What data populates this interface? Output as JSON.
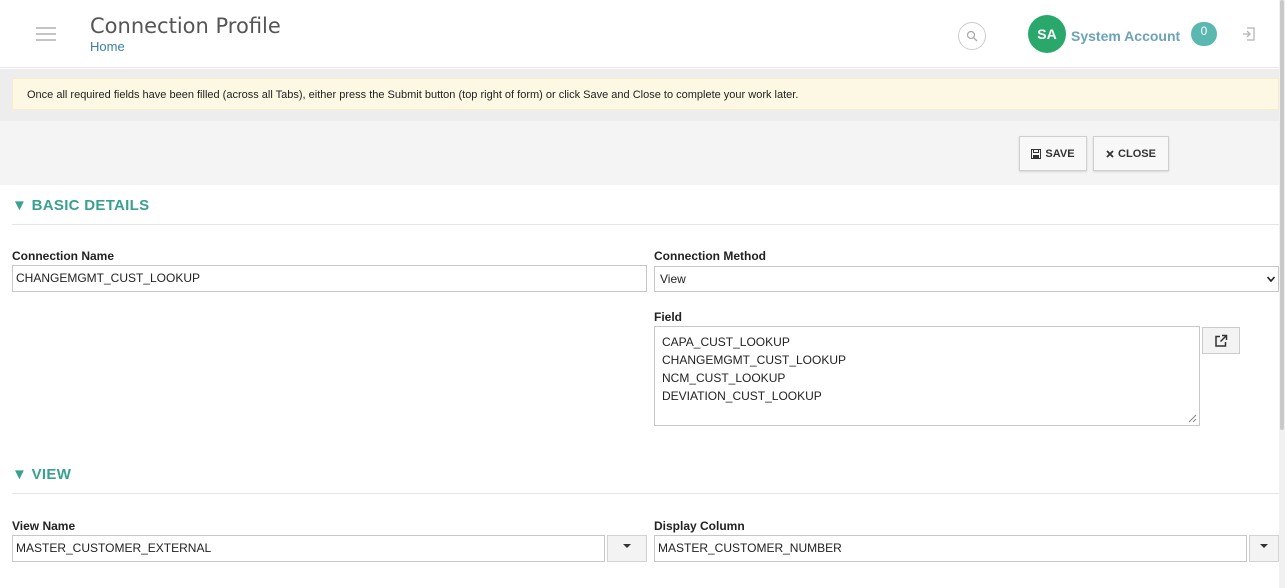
{
  "header": {
    "title": "Connection Profile",
    "breadcrumb": "Home",
    "user_initials": "SA",
    "user_name": "System Account",
    "notification_count": "0"
  },
  "notice": "Once all required fields have been filled (across all Tabs), either press the Submit button (top right of form) or click Save and Close to complete your work later.",
  "toolbar": {
    "save_label": "SAVE",
    "close_label": "CLOSE"
  },
  "basic_details": {
    "section_title": "BASIC DETAILS",
    "connection_name_label": "Connection Name",
    "connection_name_value": "CHANGEMGMT_CUST_LOOKUP",
    "connection_method_label": "Connection Method",
    "connection_method_value": "View",
    "field_label": "Field",
    "field_items": [
      "CAPA_CUST_LOOKUP",
      "CHANGEMGMT_CUST_LOOKUP",
      "NCM_CUST_LOOKUP",
      "DEVIATION_CUST_LOOKUP"
    ]
  },
  "view": {
    "section_title": "VIEW",
    "view_name_label": "View Name",
    "view_name_value": "MASTER_CUSTOMER_EXTERNAL",
    "display_column_label": "Display Column",
    "display_column_value": "MASTER_CUSTOMER_NUMBER"
  },
  "colors": {
    "accent_teal": "#3aa090",
    "avatar_green": "#2aa86b",
    "link_blue": "#3a7fa8",
    "notice_bg": "#fcf8e3"
  },
  "icons": {
    "menu": "hamburger-icon",
    "search": "search-icon",
    "logout": "logout-icon",
    "save": "floppy-disk-icon",
    "close": "close-icon",
    "open_external": "external-link-icon",
    "collapse": "triangle-down-icon"
  }
}
